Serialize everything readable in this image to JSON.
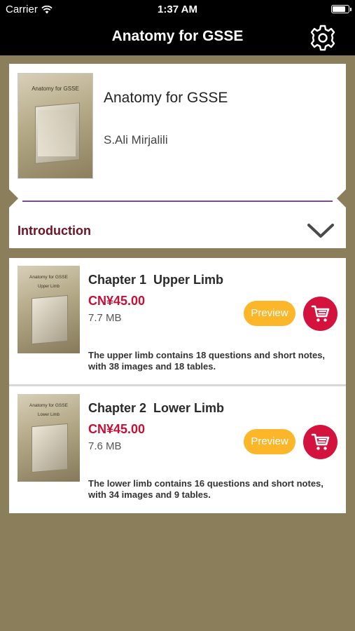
{
  "status_bar": {
    "carrier": "Carrier",
    "time": "1:37 AM",
    "battery_level": 0.9
  },
  "nav": {
    "title": "Anatomy for GSSE",
    "settings_icon": "gear-icon"
  },
  "book": {
    "name": "Anatomy for GSSE",
    "author": "S.Ali Mirjalili",
    "cover_title": "Anatomy for GSSE"
  },
  "intro": {
    "label": "Introduction",
    "toggle_icon": "chevron-down-icon"
  },
  "colors": {
    "background": "#8a7e5b",
    "price": "#c41035",
    "preview": "#fbb62a",
    "cart": "#d3133d",
    "divider": "#7b4e8b"
  },
  "chapters": [
    {
      "title": "Chapter 1  Upper Limb",
      "price": "CN¥45.00",
      "size": "7.7 MB",
      "preview_label": "Preview",
      "description": "The upper limb contains 18 questions and short notes, with 38 images and 18 tables.",
      "cover_title": "Anatomy for GSSE",
      "cover_subtitle": "Upper Limb"
    },
    {
      "title": "Chapter 2  Lower Limb",
      "price": "CN¥45.00",
      "size": "7.6 MB",
      "preview_label": "Preview",
      "description": "The lower limb contains 16 questions and short notes, with 34 images and 9 tables.",
      "cover_title": "Anatomy for GSSE",
      "cover_subtitle": "Lower Limb"
    }
  ]
}
